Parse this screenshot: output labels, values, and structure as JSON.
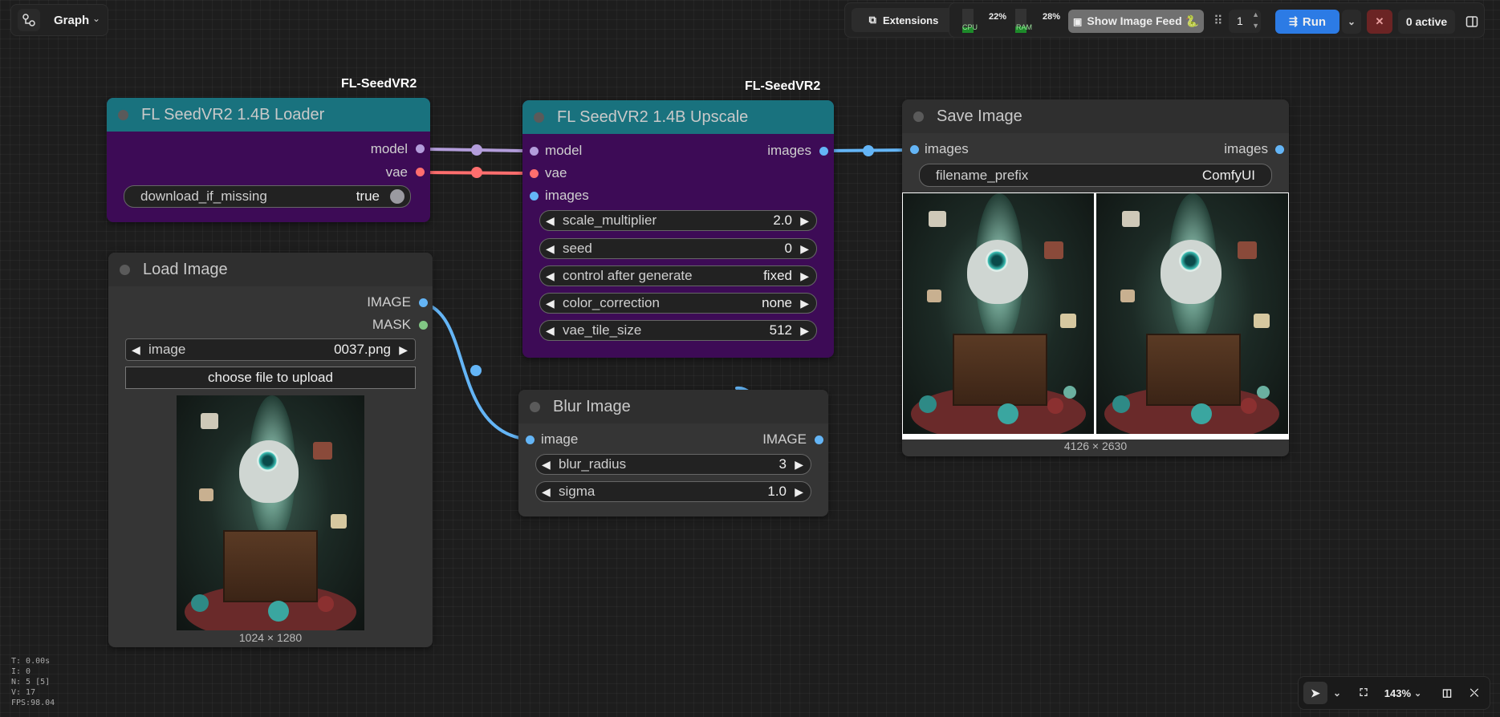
{
  "topbar": {
    "graph_label": "Graph",
    "extensions_label": "Extensions",
    "cpu_label": "CPU",
    "cpu_value": "22%",
    "cpu_fraction": 0.22,
    "ram_label": "RAM",
    "ram_value": "28%",
    "ram_fraction": 0.28,
    "image_feed_label": "Show Image Feed 🐍",
    "batch_count": "1",
    "run_label": "Run",
    "active_label": "0 active"
  },
  "nodes": {
    "loader": {
      "badge": "FL-SeedVR2",
      "title": "FL SeedVR2 1.4B Loader",
      "outputs": [
        "model",
        "vae"
      ],
      "widget_label": "download_if_missing",
      "widget_value": "true"
    },
    "upscale": {
      "badge": "FL-SeedVR2",
      "title": "FL SeedVR2 1.4B Upscale",
      "inputs": [
        "model",
        "vae",
        "images"
      ],
      "output": "images",
      "widgets": [
        {
          "label": "scale_multiplier",
          "value": "2.0"
        },
        {
          "label": "seed",
          "value": "0"
        },
        {
          "label": "control after generate",
          "value": "fixed"
        },
        {
          "label": "color_correction",
          "value": "none"
        },
        {
          "label": "vae_tile_size",
          "value": "512"
        }
      ]
    },
    "save": {
      "title": "Save Image",
      "input": "images",
      "output": "images",
      "widget_label": "filename_prefix",
      "widget_value": "ComfyUI",
      "dims": "4126 × 2630"
    },
    "load": {
      "title": "Load Image",
      "outputs": [
        "IMAGE",
        "MASK"
      ],
      "widget_label": "image",
      "widget_value": "0037.png",
      "upload_label": "choose file to upload",
      "dims": "1024 × 1280"
    },
    "blur": {
      "title": "Blur Image",
      "input": "image",
      "output": "IMAGE",
      "widgets": [
        {
          "label": "blur_radius",
          "value": "3"
        },
        {
          "label": "sigma",
          "value": "1.0"
        }
      ]
    }
  },
  "stats": {
    "t": "T: 0.00s",
    "i": "I: 0",
    "n": "N: 5 [5]",
    "v": "V: 17",
    "fps": "FPS:98.04"
  },
  "bottom_toolbar": {
    "zoom": "143%"
  },
  "colors": {
    "teal_header": "#19727e",
    "purple_body": "#3d0b56",
    "run_blue": "#2c7be5",
    "link_model": "#b39ddb",
    "link_vae": "#ff6e6e",
    "link_image": "#64b5f6"
  }
}
